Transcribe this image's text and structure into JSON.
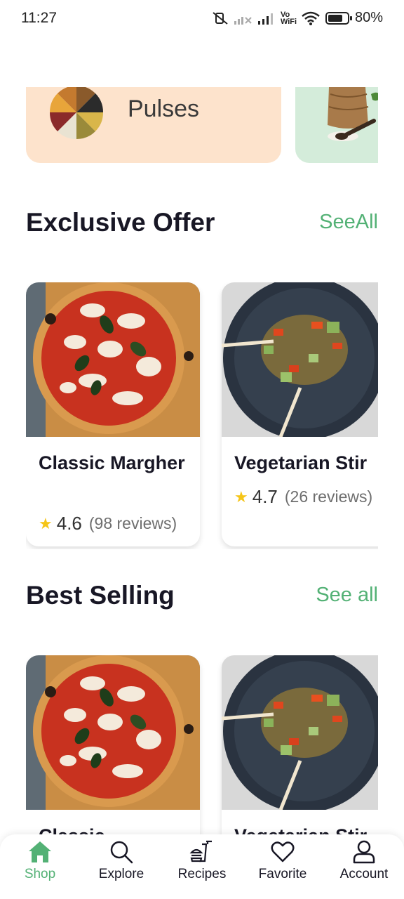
{
  "status_bar": {
    "time": "11:27",
    "battery_text": "80%",
    "battery_level": 0.8,
    "wifi_label": "Vo WiFi"
  },
  "categories": [
    {
      "label": "Pulses",
      "bg_color": "#fde3cc"
    },
    {
      "label": "",
      "bg_color": "#d4ecda"
    }
  ],
  "exclusive": {
    "title": "Exclusive Offer",
    "link": "SeeAll",
    "items": [
      {
        "name": "Classic Margher",
        "rating": "4.6",
        "reviews": "(98 reviews)"
      },
      {
        "name": "Vegetarian Stir",
        "rating": "4.7",
        "reviews": "(26 reviews)"
      }
    ]
  },
  "best_selling": {
    "title": "Best Selling",
    "link": "See all",
    "items": [
      {
        "name": "Classic"
      },
      {
        "name": "Vegetarian Stir"
      }
    ]
  },
  "nav": {
    "items": [
      {
        "label": "Shop",
        "icon": "shop-icon",
        "active": true
      },
      {
        "label": "Explore",
        "icon": "search-icon"
      },
      {
        "label": "Recipes",
        "icon": "recipes-icon"
      },
      {
        "label": "Favorite",
        "icon": "heart-icon"
      },
      {
        "label": "Account",
        "icon": "user-icon"
      }
    ]
  },
  "colors": {
    "accent": "#53b175",
    "star": "#f5c518",
    "text": "#181725"
  }
}
